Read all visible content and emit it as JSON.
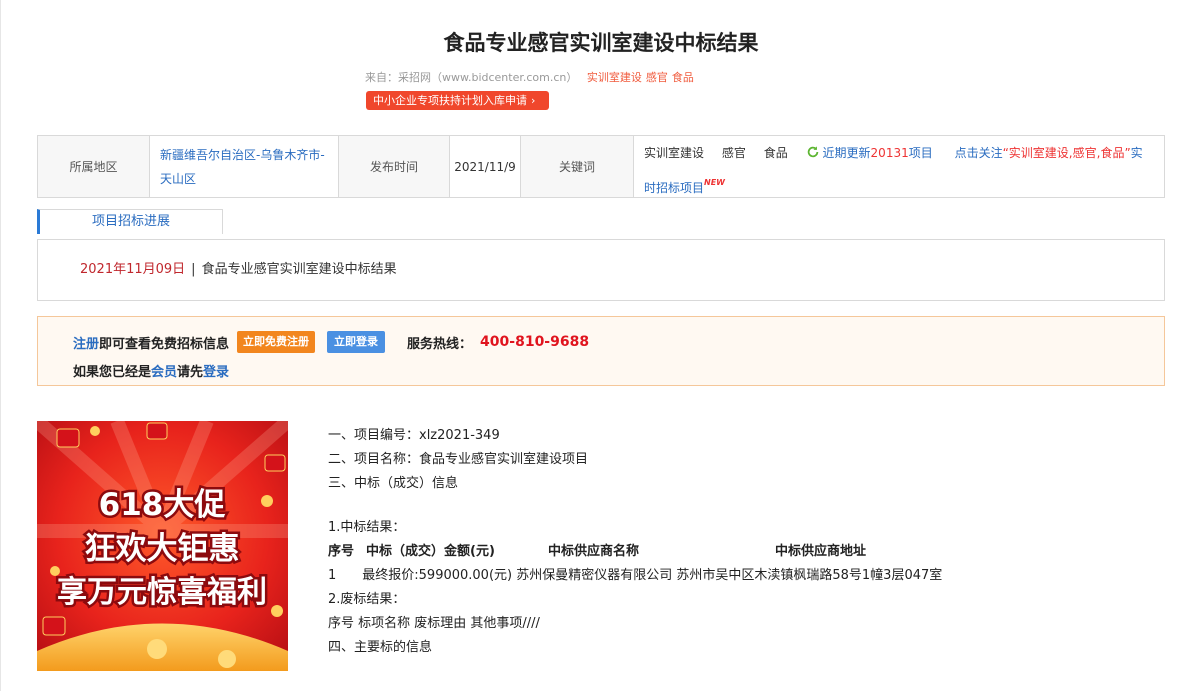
{
  "header": {
    "title": "食品专业感官实训室建设中标结果",
    "source_text": "来自：采招网（www.bidcenter.com.cn）",
    "tags": [
      "实训室建设",
      "感官",
      "食品"
    ],
    "promo_button": "中小企业专项扶持计划入库申请"
  },
  "info": {
    "region_label": "所属地区",
    "region_value": "新疆维吾尔自治区-乌鲁木齐市-天山区",
    "time_label": "发布时间",
    "time_value": "2021/11/9",
    "keyword_label": "关键词",
    "keywords": [
      "实训室建设",
      "感官",
      "食品"
    ],
    "recent_prefix": "近期更新",
    "recent_count": "20131",
    "recent_suffix": "项目",
    "follow_prefix": "点击关注",
    "follow_keywords": "“实训室建设,感官,食品”",
    "follow_suffix": "实时招标项目",
    "new_badge": "NEW"
  },
  "progress": {
    "tab_label": "项目招标进展",
    "date": "2021年11月09日",
    "separator": "|",
    "item_title": "食品专业感官实训室建设中标结果"
  },
  "login": {
    "register_link": "注册",
    "register_text": "即可查看免费招标信息",
    "register_button": "立即免费注册",
    "login_button": "立即登录",
    "hotline_label": "服务热线：",
    "hotline": "400-810-9688",
    "member_prefix": "如果您已经是",
    "member_link": "会员",
    "member_mid": "请先",
    "login_link": "登录"
  },
  "ad": {
    "line1": "618大促",
    "line2": "狂欢大钜惠",
    "line3": "享万元惊喜福利"
  },
  "content": {
    "line1": "一、项目编号：xlz2021-349",
    "line2": "二、项目名称：食品专业感官实训室建设项目",
    "line3": "三、中标（成交）信息",
    "line4": "1.中标结果：",
    "header_cols": [
      "序号",
      "中标（成交）金额(元)",
      "中标供应商名称",
      "中标供应商地址"
    ],
    "row1": "1　　最终报价:599000.00(元) 苏州保曼精密仪器有限公司 苏州市吴中区木渎镇枫瑞路58号1幢3层047室",
    "line5": "2.废标结果：",
    "line6": "序号 标项名称 废标理由 其他事项////",
    "line7": "四、主要标的信息"
  }
}
